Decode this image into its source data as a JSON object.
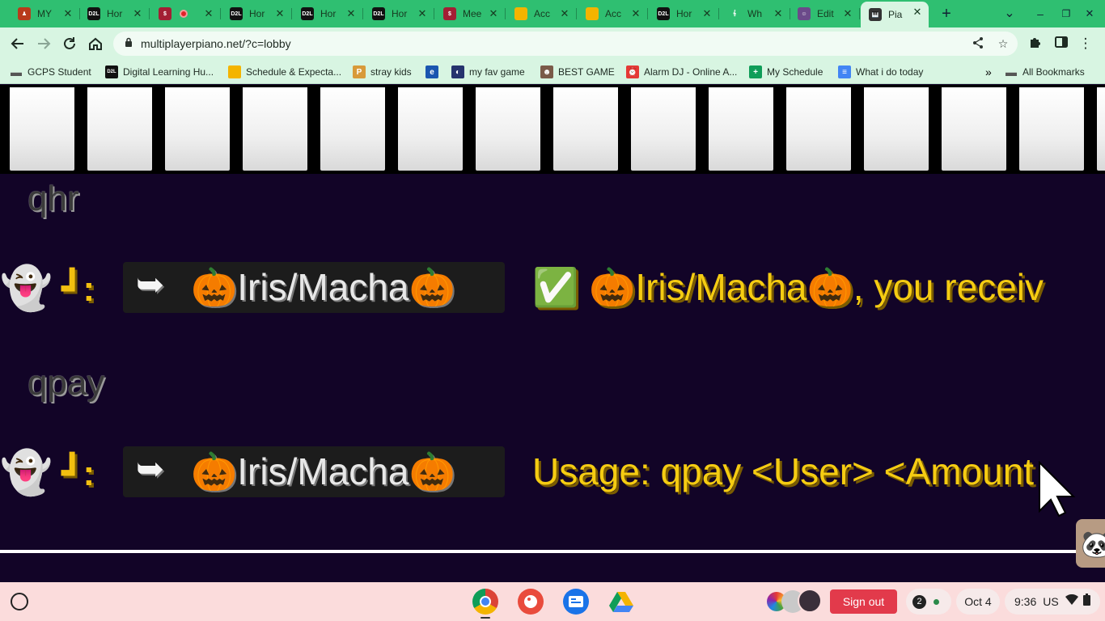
{
  "tabs": [
    {
      "title": "MY",
      "icon_color": "#b83b1b",
      "icon_glyph": "♟"
    },
    {
      "title": "Hor",
      "icon_color": "#111111",
      "icon_glyph": "D2L"
    },
    {
      "title": "",
      "icon_color": "#a31f34",
      "icon_glyph": "$",
      "recording": true
    },
    {
      "title": "Hor",
      "icon_color": "#111111",
      "icon_glyph": "D2L"
    },
    {
      "title": "Hor",
      "icon_color": "#111111",
      "icon_glyph": "D2L"
    },
    {
      "title": "Hor",
      "icon_color": "#111111",
      "icon_glyph": "D2L"
    },
    {
      "title": "Mee",
      "icon_color": "#a31f34",
      "icon_glyph": "$"
    },
    {
      "title": "Acc",
      "icon_color": "#f4b400",
      "icon_glyph": ""
    },
    {
      "title": "Acc",
      "icon_color": "#f4b400",
      "icon_glyph": ""
    },
    {
      "title": "Hor",
      "icon_color": "#111111",
      "icon_glyph": "D2L"
    },
    {
      "title": "Wh",
      "icon_color": "#2fbf71",
      "icon_glyph": "𝄞"
    },
    {
      "title": "Edit",
      "icon_color": "#6b4a8a",
      "icon_glyph": "☺"
    },
    {
      "title": "Pia",
      "icon_color": "#333333",
      "icon_glyph": "🎹",
      "active": true
    }
  ],
  "toolbar": {
    "url": "multiplayerpiano.net/?c=lobby"
  },
  "bookmarks": [
    {
      "label": "GCPS Student",
      "icon": "folder",
      "color": "#555555"
    },
    {
      "label": "Digital Learning Hu...",
      "icon": "D2L",
      "color": "#111111"
    },
    {
      "label": "Schedule & Expecta...",
      "icon": "slides",
      "color": "#f4b400"
    },
    {
      "label": "stray kids",
      "icon": "pinterest",
      "color": "#d89a3a"
    },
    {
      "label": "",
      "icon": "e",
      "color": "#1a56b0"
    },
    {
      "label": "my fav game",
      "icon": "game",
      "color": "#26336e"
    },
    {
      "label": "BEST GAME",
      "icon": "face",
      "color": "#7a5a48"
    },
    {
      "label": "Alarm DJ - Online A...",
      "icon": "alarm",
      "color": "#e53935"
    },
    {
      "label": "My Schedule",
      "icon": "sheets",
      "color": "#0f9d58"
    },
    {
      "label": "What i do today",
      "icon": "docs",
      "color": "#4285f4"
    },
    {
      "label": "All Bookmarks",
      "icon": "folder",
      "color": "#555555"
    }
  ],
  "chat": {
    "commands": [
      "qhr",
      "qpay"
    ],
    "bot_prefix": "┛:",
    "user_tag": "🎃Iris/Macha🎃",
    "messages": [
      {
        "text": "🎃Iris/Macha🎃, you receiv",
        "checkmark": "✅"
      },
      {
        "text": "Usage: qpay <User> <Amount"
      }
    ]
  },
  "shelf": {
    "sign_out_label": "Sign out",
    "notification_count": "2",
    "date": "Oct 4",
    "time": "9:36",
    "locale": "US"
  }
}
